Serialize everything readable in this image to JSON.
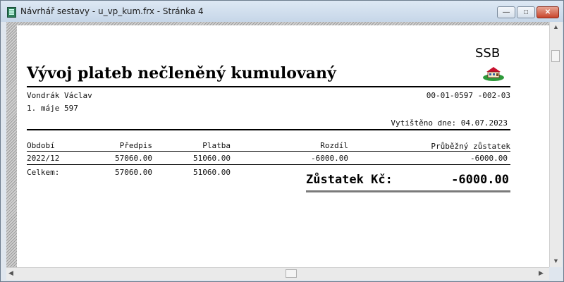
{
  "window": {
    "title": "Návrhář sestavy - u_vp_kum.frx - Stránka 4",
    "minimize_glyph": "—",
    "maximize_glyph": "□",
    "close_glyph": "✕"
  },
  "report": {
    "title": "Vývoj plateb nečleněný kumulovaný",
    "logo_text": "SSB",
    "name": "Vondrák Václav",
    "address": "1. máje 597",
    "account": "00-01-0597 -002-03",
    "printed": "Vytištěno dne: 04.07.2023",
    "columns": [
      "Období",
      "Předpis",
      "Platba",
      "Rozdíl",
      "Průběžný zůstatek"
    ],
    "rows": [
      [
        "2022/12",
        "57060.00",
        "51060.00",
        "-6000.00",
        "-6000.00"
      ]
    ],
    "total": {
      "label": "Celkem:",
      "predpis": "57060.00",
      "platba": "51060.00"
    },
    "balance_label": "Zůstatek Kč:",
    "balance_value": "-6000.00"
  },
  "icons": {
    "app": "report-designer-icon",
    "logo": "house-icon",
    "scroll_up": "arrow-up-icon",
    "scroll_down": "arrow-down-icon",
    "scroll_left": "arrow-left-icon",
    "scroll_right": "arrow-right-icon"
  }
}
